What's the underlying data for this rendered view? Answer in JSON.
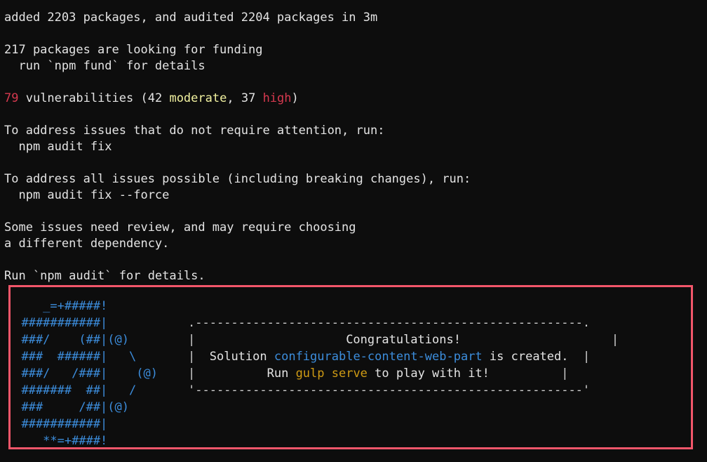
{
  "terminal": {
    "title": "npm install output",
    "background_color": "#0d0d0d",
    "foreground_color": "#e4e4e4",
    "accent_colors": {
      "error_red": "#d6394f",
      "moderate_yellow": "#f2f2a0",
      "command_amber": "#cf9b14",
      "ascii_blue": "#3c8ddc",
      "highlight_border": "#f2566a"
    }
  },
  "output": {
    "install_summary": {
      "added_prefix": "added ",
      "added_count": "2203",
      "added_mid": " packages, and audited ",
      "audited_count": "2204",
      "added_suffix": " packages in ",
      "duration": "3m",
      "full_line": "added 2203 packages, and audited 2204 packages in 3m"
    },
    "funding": {
      "count_line": "217 packages are looking for funding",
      "details_line": "  run `npm fund` for details"
    },
    "vulnerabilities": {
      "total": "79",
      "label": " vulnerabilities (",
      "moderate_count": "42",
      "moderate_label": "moderate",
      "separator": ", ",
      "high_count": "37",
      "high_label": "high",
      "close_paren": ")"
    },
    "fix_hint": {
      "heading": "To address issues that do not require attention, run:",
      "command": "  npm audit fix"
    },
    "force_hint": {
      "heading": "To address all issues possible (including breaking changes), run:",
      "command": "  npm audit fix --force"
    },
    "review_notice": {
      "line1": "Some issues need review, and may require choosing",
      "line2": "a different dependency."
    },
    "audit_details": "Run `npm audit` for details."
  },
  "scaffold": {
    "ascii_art": [
      "     _=+#####!",
      "  ###########|",
      "  ###/    (##|(@)",
      "  ###  ######|   \\",
      "  ###/   /###|    (@)",
      "  #######  ##|   /",
      "  ###     /##|(@)",
      "  ###########|",
      "     **=+####!"
    ],
    "message_box": {
      "border_top": ".------------------------------------------------------.",
      "border_bottom": "'------------------------------------------------------'",
      "side": "|",
      "line1": "Congratulations!",
      "line2_prefix": "Solution ",
      "line2_solution": "configurable-content-web-part",
      "line2_suffix": " is created.",
      "line3_prefix": "Run ",
      "line3_command": "gulp serve",
      "line3_suffix": " to play with it!"
    }
  }
}
